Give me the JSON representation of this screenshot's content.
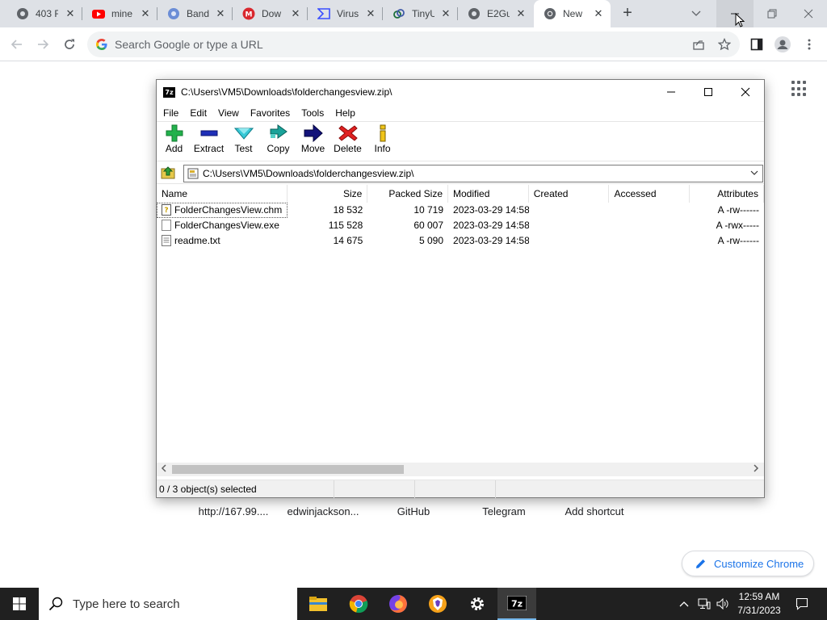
{
  "browser": {
    "tabs": [
      {
        "title": "403 F",
        "icon": "globe-icon"
      },
      {
        "title": "mine",
        "icon": "youtube-icon"
      },
      {
        "title": "Band",
        "icon": "bandcamp-icon"
      },
      {
        "title": "Dow",
        "icon": "mega-icon"
      },
      {
        "title": "Virus",
        "icon": "virustotal-icon"
      },
      {
        "title": "TinyU",
        "icon": "tinyurl-icon"
      },
      {
        "title": "E2Gu",
        "icon": "globe-icon"
      },
      {
        "title": "New",
        "icon": "chrome-icon",
        "active": true
      }
    ],
    "omnibox_placeholder": "Search Google or type a URL"
  },
  "newtab": {
    "shortcuts": [
      "http://167.99....",
      "edwinjackson...",
      "GitHub",
      "Telegram",
      "Add shortcut"
    ],
    "customize_label": "Customize Chrome"
  },
  "sevenzip": {
    "title": "C:\\Users\\VM5\\Downloads\\folderchangesview.zip\\",
    "menu": [
      "File",
      "Edit",
      "View",
      "Favorites",
      "Tools",
      "Help"
    ],
    "toolbar": [
      "Add",
      "Extract",
      "Test",
      "Copy",
      "Move",
      "Delete",
      "Info"
    ],
    "address": "C:\\Users\\VM5\\Downloads\\folderchangesview.zip\\",
    "columns": [
      "Name",
      "Size",
      "Packed Size",
      "Modified",
      "Created",
      "Accessed",
      "Attributes"
    ],
    "files": [
      {
        "name": "FolderChangesView.chm",
        "size": "18 532",
        "packed": "10 719",
        "modified": "2023-03-29 14:58",
        "created": "",
        "accessed": "",
        "attr": "A -rw------"
      },
      {
        "name": "FolderChangesView.exe",
        "size": "115 528",
        "packed": "60 007",
        "modified": "2023-03-29 14:58",
        "created": "",
        "accessed": "",
        "attr": "A -rwx-----"
      },
      {
        "name": "readme.txt",
        "size": "14 675",
        "packed": "5 090",
        "modified": "2023-03-29 14:58",
        "created": "",
        "accessed": "",
        "attr": "A -rw------"
      }
    ],
    "status": "0 / 3 object(s) selected"
  },
  "taskbar": {
    "search_placeholder": "Type here to search",
    "time": "12:59 AM",
    "date": "7/31/2023"
  },
  "colors": {
    "chrome_tabstrip": "#dee1e6",
    "taskbar": "#202020",
    "accent_blue": "#1a73e8"
  }
}
